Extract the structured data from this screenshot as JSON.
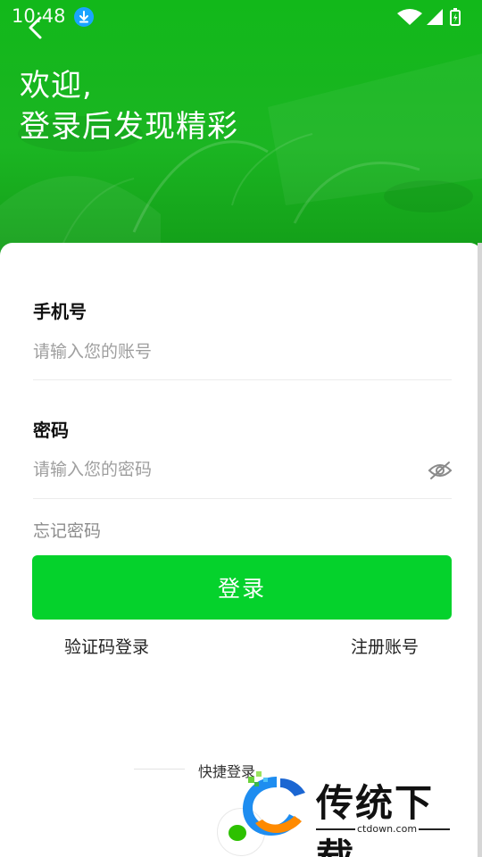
{
  "status_bar": {
    "time": "10:48"
  },
  "header": {
    "welcome_line1": "欢迎,",
    "welcome_line2": "登录后发现精彩"
  },
  "form": {
    "phone_label": "手机号",
    "phone_placeholder": "请输入您的账号",
    "phone_value": "",
    "password_label": "密码",
    "password_placeholder": "请输入您的密码",
    "password_value": "",
    "forgot_label": "忘记密码",
    "login_button": "登录",
    "sms_login_link": "验证码登录",
    "register_link": "注册账号"
  },
  "quick_login": {
    "label": "快捷登录"
  },
  "watermark": {
    "brand": "传统下载",
    "url": "ctdown.com"
  },
  "colors": {
    "primary": "#05d22c",
    "header_green": "#1bb522",
    "placeholder": "#9e9e9e",
    "download_badge": "#1aa4ff"
  },
  "icons": [
    "back-arrow-icon",
    "eye-hidden-icon",
    "wechat-icon",
    "wifi-icon",
    "signal-icon",
    "battery-icon",
    "download-icon"
  ]
}
